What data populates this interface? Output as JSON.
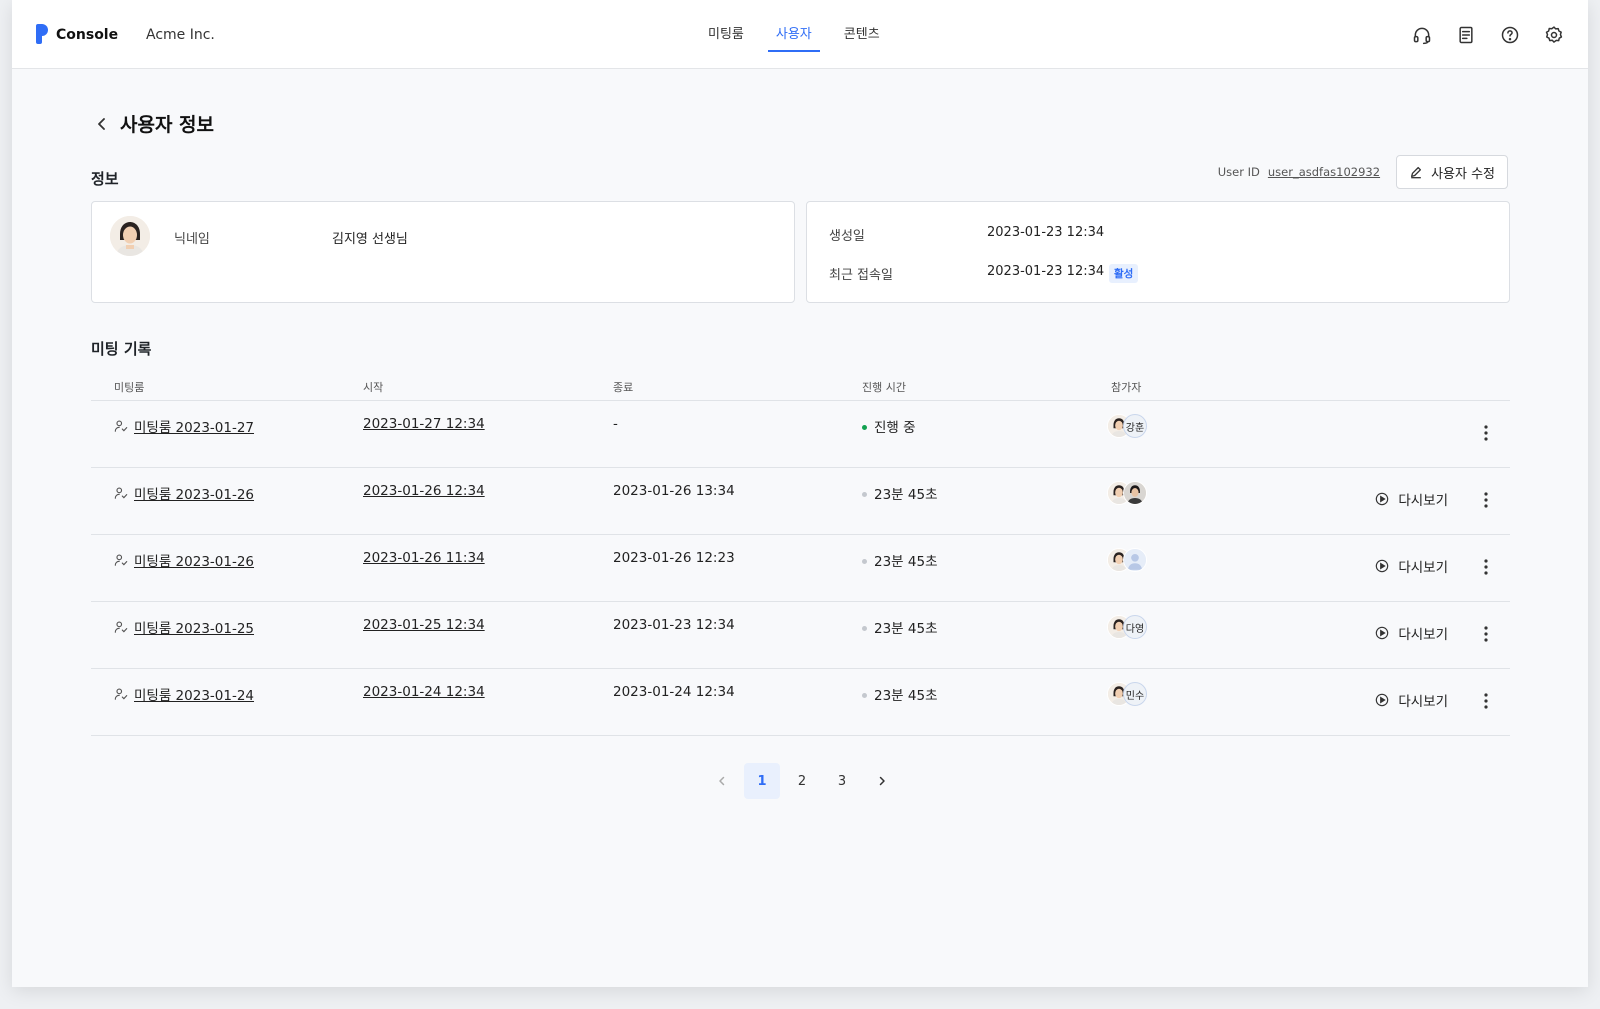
{
  "header": {
    "brand": "Console",
    "org": "Acme Inc.",
    "tabs": [
      {
        "label": "미팅룸"
      },
      {
        "label": "사용자"
      },
      {
        "label": "콘텐츠"
      }
    ],
    "active_tab": "사용자",
    "icons": [
      "headset-icon",
      "document-icon",
      "help-icon",
      "settings-icon"
    ]
  },
  "page": {
    "title": "사용자 정보"
  },
  "info": {
    "section": "정보",
    "user_id_label": "User ID",
    "user_id": "user_asdfas102932",
    "edit_label": "사용자 수정",
    "nickname_label": "닉네임",
    "nickname": "김지영 선생님",
    "created_label": "생성일",
    "created": "2023-01-23 12:34",
    "last_login_label": "최근 접속일",
    "last_login": "2023-01-23 12:34",
    "status_badge": "활성"
  },
  "meetings": {
    "section": "미팅 기록",
    "columns": [
      "미팅룸",
      "시작",
      "종료",
      "진행 시간",
      "참가자"
    ],
    "replay_label": "다시보기",
    "rows": [
      {
        "room": "미팅룸 2023-01-27",
        "start": "2023-01-27 12:34",
        "end": "-",
        "duration": "진행 중",
        "live": true,
        "participant_tag": "강훈"
      },
      {
        "room": "미팅룸 2023-01-26",
        "start": "2023-01-26 12:34",
        "end": "2023-01-26 13:34",
        "duration": "23분 45초",
        "live": false,
        "participant_tag": ""
      },
      {
        "room": "미팅룸 2023-01-26",
        "start": "2023-01-26 11:34",
        "end": "2023-01-26 12:23",
        "duration": "23분 45초",
        "live": false,
        "participant_tag": ""
      },
      {
        "room": "미팅룸 2023-01-25",
        "start": "2023-01-25 12:34",
        "end": "2023-01-23 12:34",
        "duration": "23분 45초",
        "live": false,
        "participant_tag": "다영"
      },
      {
        "room": "미팅룸 2023-01-24",
        "start": "2023-01-24 12:34",
        "end": "2023-01-24 12:34",
        "duration": "23분 45초",
        "live": false,
        "participant_tag": "민수"
      }
    ]
  },
  "pagination": {
    "pages": [
      "1",
      "2",
      "3"
    ],
    "current": "1"
  },
  "colors": {
    "accent": "#2f6df6",
    "live": "#12a150",
    "idle": "#c4c8ce"
  }
}
